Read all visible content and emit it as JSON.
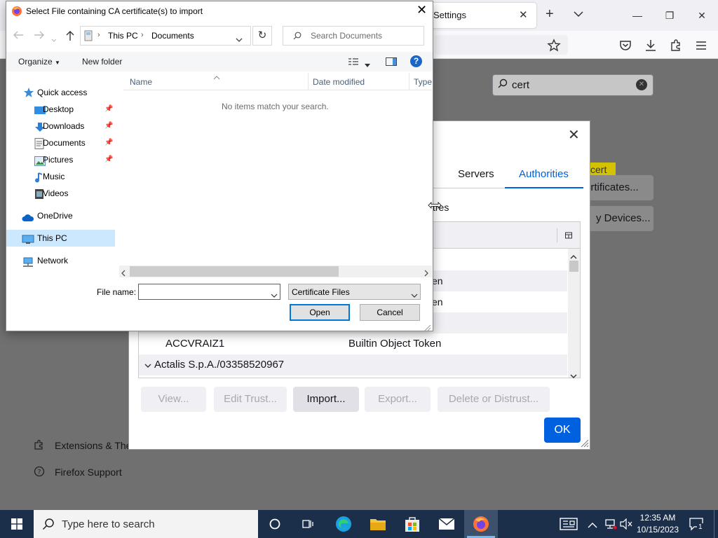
{
  "firefox": {
    "tab_title": "Settings",
    "search_value": "cert",
    "highlight": "cert",
    "view_certs_btn": "ertificates...",
    "security_devices_btn": "y Devices...",
    "footer": {
      "extensions": "Extensions & The",
      "support": "Firefox Support"
    }
  },
  "cert_manager": {
    "tabs": {
      "servers": "Servers",
      "authorities": "Authorities"
    },
    "description": "tres",
    "rows": [
      {
        "name": "",
        "token": "en"
      },
      {
        "name": "",
        "token": "en"
      },
      {
        "name": "ACCVRAIZ1",
        "token": "Builtin Object Token"
      },
      {
        "group": "Actalis S.p.A./03358520967"
      }
    ],
    "buttons": {
      "view": "View...",
      "edit_trust": "Edit Trust...",
      "import": "Import...",
      "export": "Export...",
      "delete": "Delete or Distrust...",
      "ok": "OK"
    }
  },
  "file_dialog": {
    "title": "Select File containing CA certificate(s) to import",
    "breadcrumb": [
      "This PC",
      "Documents"
    ],
    "search_placeholder": "Search Documents",
    "commands": {
      "organize": "Organize",
      "new_folder": "New folder"
    },
    "nav": {
      "quick_access": "Quick access",
      "desktop": "Desktop",
      "downloads": "Downloads",
      "documents": "Documents",
      "pictures": "Pictures",
      "music": "Music",
      "videos": "Videos",
      "onedrive": "OneDrive",
      "this_pc": "This PC",
      "network": "Network"
    },
    "columns": {
      "name": "Name",
      "date_modified": "Date modified",
      "type": "Type"
    },
    "empty_message": "No items match your search.",
    "file_name_label": "File name:",
    "file_name_value": "",
    "file_type": "Certificate Files",
    "open": "Open",
    "cancel": "Cancel"
  },
  "taskbar": {
    "search_placeholder": "Type here to search",
    "time": "12:35 AM",
    "date": "10/15/2023",
    "notification_count": "1"
  },
  "colors": {
    "accent": "#0061e0",
    "taskbar": "#1c2f4a",
    "win_accent": "#0078d7"
  }
}
